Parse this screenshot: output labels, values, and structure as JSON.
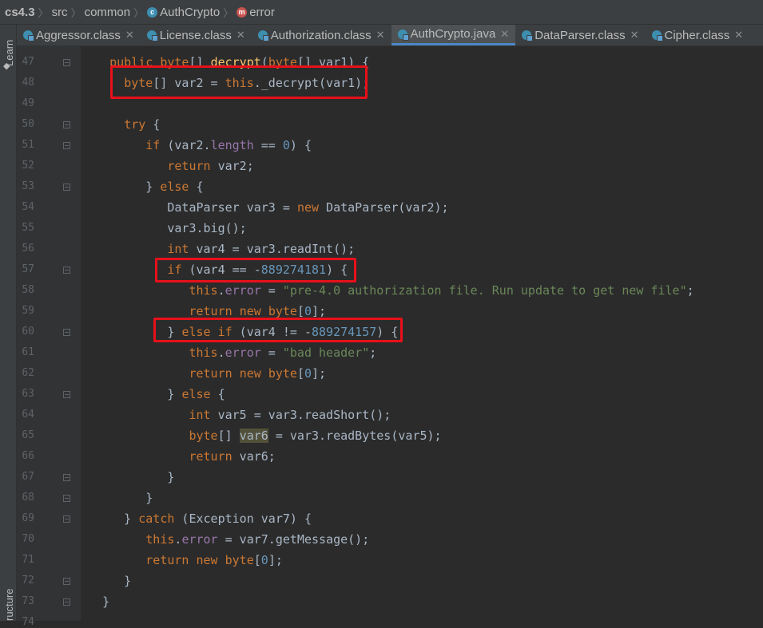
{
  "breadcrumb": {
    "project": "cs4.3",
    "items": [
      "src",
      "common",
      "AuthCrypto",
      "error"
    ]
  },
  "side_panels": {
    "top": "Learn",
    "bottom": "ructure"
  },
  "tabs": [
    {
      "label": "Aggressor.class",
      "active": false
    },
    {
      "label": "License.class",
      "active": false
    },
    {
      "label": "Authorization.class",
      "active": false
    },
    {
      "label": "AuthCrypto.java",
      "active": true
    },
    {
      "label": "DataParser.class",
      "active": false
    },
    {
      "label": "Cipher.class",
      "active": false
    }
  ],
  "editor": {
    "line_numbers": [
      "47",
      "48",
      "49",
      "50",
      "51",
      "52",
      "53",
      "54",
      "55",
      "56",
      "57",
      "58",
      "59",
      "60",
      "61",
      "62",
      "63",
      "64",
      "65",
      "66",
      "67",
      "68",
      "69",
      "70",
      "71",
      "72",
      "73",
      "74"
    ],
    "lines": [
      [
        [
          "    ",
          "ident"
        ],
        [
          "public",
          "kw"
        ],
        [
          " ",
          "ident"
        ],
        [
          "byte",
          "kw"
        ],
        [
          "[] ",
          "ident"
        ],
        [
          "decrypt",
          "fn"
        ],
        [
          "(",
          "ident"
        ],
        [
          "byte",
          "kw"
        ],
        [
          "[] var1) {",
          "ident"
        ]
      ],
      [
        [
          "      ",
          "ident"
        ],
        [
          "byte",
          "kw"
        ],
        [
          "[] var2 = ",
          "ident"
        ],
        [
          "this",
          "kw"
        ],
        [
          "._decrypt(var1);",
          "ident"
        ]
      ],
      [],
      [
        [
          "      ",
          "ident"
        ],
        [
          "try",
          "kw"
        ],
        [
          " {",
          "ident"
        ]
      ],
      [
        [
          "         ",
          "ident"
        ],
        [
          "if",
          "kw"
        ],
        [
          " (var2.",
          "ident"
        ],
        [
          "length",
          "fld"
        ],
        [
          " == ",
          "ident"
        ],
        [
          "0",
          "num"
        ],
        [
          ") {",
          "ident"
        ]
      ],
      [
        [
          "            ",
          "ident"
        ],
        [
          "return",
          "kw"
        ],
        [
          " var2;",
          "ident"
        ]
      ],
      [
        [
          "         } ",
          "ident"
        ],
        [
          "else",
          "kw"
        ],
        [
          " {",
          "ident"
        ]
      ],
      [
        [
          "            DataParser var3 = ",
          "ident"
        ],
        [
          "new",
          "kw"
        ],
        [
          " DataParser(var2);",
          "ident"
        ]
      ],
      [
        [
          "            var3.big();",
          "ident"
        ]
      ],
      [
        [
          "            ",
          "ident"
        ],
        [
          "int",
          "kw"
        ],
        [
          " var4 = var3.readInt();",
          "ident"
        ]
      ],
      [
        [
          "            ",
          "ident"
        ],
        [
          "if",
          "kw"
        ],
        [
          " (var4 == -",
          "ident"
        ],
        [
          "889274181",
          "num"
        ],
        [
          ") {",
          "ident"
        ]
      ],
      [
        [
          "               ",
          "ident"
        ],
        [
          "this",
          "kw"
        ],
        [
          ".",
          "ident"
        ],
        [
          "error",
          "fld"
        ],
        [
          " = ",
          "ident"
        ],
        [
          "\"pre-4.0 authorization file. Run update to get new file\"",
          "str"
        ],
        [
          ";",
          "ident"
        ]
      ],
      [
        [
          "               ",
          "ident"
        ],
        [
          "return",
          "kw"
        ],
        [
          " ",
          "ident"
        ],
        [
          "new",
          "kw"
        ],
        [
          " ",
          "ident"
        ],
        [
          "byte",
          "kw"
        ],
        [
          "[",
          "ident"
        ],
        [
          "0",
          "num"
        ],
        [
          "];",
          "ident"
        ]
      ],
      [
        [
          "            } ",
          "ident"
        ],
        [
          "else if",
          "kw"
        ],
        [
          " (var4 != -",
          "ident"
        ],
        [
          "889274157",
          "num"
        ],
        [
          ") {",
          "ident"
        ]
      ],
      [
        [
          "               ",
          "ident"
        ],
        [
          "this",
          "kw"
        ],
        [
          ".",
          "ident"
        ],
        [
          "error",
          "fld"
        ],
        [
          " = ",
          "ident"
        ],
        [
          "\"bad header\"",
          "str"
        ],
        [
          ";",
          "ident"
        ]
      ],
      [
        [
          "               ",
          "ident"
        ],
        [
          "return",
          "kw"
        ],
        [
          " ",
          "ident"
        ],
        [
          "new",
          "kw"
        ],
        [
          " ",
          "ident"
        ],
        [
          "byte",
          "kw"
        ],
        [
          "[",
          "ident"
        ],
        [
          "0",
          "num"
        ],
        [
          "];",
          "ident"
        ]
      ],
      [
        [
          "            } ",
          "ident"
        ],
        [
          "else",
          "kw"
        ],
        [
          " {",
          "ident"
        ]
      ],
      [
        [
          "               ",
          "ident"
        ],
        [
          "int",
          "kw"
        ],
        [
          " var5 = var3.readShort();",
          "ident"
        ]
      ],
      [
        [
          "               ",
          "ident"
        ],
        [
          "byte",
          "kw"
        ],
        [
          "[] ",
          "ident"
        ],
        [
          "var6",
          "hl"
        ],
        [
          " = var3.readBytes(var5);",
          "ident"
        ]
      ],
      [
        [
          "               ",
          "ident"
        ],
        [
          "return",
          "kw"
        ],
        [
          " var6;",
          "ident"
        ]
      ],
      [
        [
          "            }",
          "ident"
        ]
      ],
      [
        [
          "         }",
          "ident"
        ]
      ],
      [
        [
          "      } ",
          "ident"
        ],
        [
          "catch",
          "kw"
        ],
        [
          " (Exception var7) {",
          "ident"
        ]
      ],
      [
        [
          "         ",
          "ident"
        ],
        [
          "this",
          "kw"
        ],
        [
          ".",
          "ident"
        ],
        [
          "error",
          "fld"
        ],
        [
          " = var7.getMessage();",
          "ident"
        ]
      ],
      [
        [
          "         ",
          "ident"
        ],
        [
          "return",
          "kw"
        ],
        [
          " ",
          "ident"
        ],
        [
          "new",
          "kw"
        ],
        [
          " ",
          "ident"
        ],
        [
          "byte",
          "kw"
        ],
        [
          "[",
          "ident"
        ],
        [
          "0",
          "num"
        ],
        [
          "];",
          "ident"
        ]
      ],
      [
        [
          "      }",
          "ident"
        ]
      ],
      [
        [
          "   }",
          "ident"
        ]
      ],
      []
    ],
    "highlight_color": "#e8101a"
  }
}
